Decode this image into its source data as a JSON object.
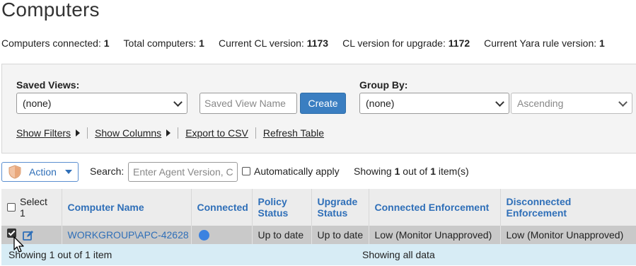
{
  "page": {
    "title": "Computers"
  },
  "stats": [
    {
      "label": "Computers connected:",
      "value": "1"
    },
    {
      "label": "Total computers:",
      "value": "1"
    },
    {
      "label": "Current CL version:",
      "value": "1173"
    },
    {
      "label": "CL version for upgrade:",
      "value": "1172"
    },
    {
      "label": "Current Yara rule version:",
      "value": "1"
    }
  ],
  "filters": {
    "saved_views_label": "Saved Views:",
    "saved_views_value": "(none)",
    "saved_view_name_placeholder": "Saved View Name",
    "create_label": "Create",
    "group_by_label": "Group By:",
    "group_by_value": "(none)",
    "sort_value": "Ascending",
    "links": {
      "show_filters": "Show Filters",
      "show_columns": "Show Columns",
      "export_csv": "Export to CSV",
      "refresh_table": "Refresh Table"
    }
  },
  "toolbar": {
    "action_label": "Action",
    "search_label": "Search:",
    "search_placeholder": "Enter Agent Version, C",
    "auto_apply_label": "Automatically apply",
    "showing_prefix": "Showing",
    "showing_count": "1",
    "showing_mid": "out of",
    "showing_total": "1",
    "showing_suffix": "item(s)"
  },
  "table": {
    "columns": {
      "select": "Select 1",
      "computer_name": "Computer Name",
      "connected": "Connected",
      "policy_status": "Policy Status",
      "upgrade_status": "Upgrade Status",
      "connected_enforcement": "Connected Enforcement",
      "disconnected_enforcement": "Disconnected Enforcement"
    },
    "rows": [
      {
        "computer_name": "WORKGROUP\\APC-42628",
        "policy_status": "Up to date",
        "upgrade_status": "Up to date",
        "connected_enforcement": "Low (Monitor Unapproved)",
        "disconnected_enforcement": "Low (Monitor Unapproved)"
      }
    ]
  },
  "footer": {
    "left": "Showing 1 out of 1 item",
    "middle": "Showing all data"
  },
  "colors": {
    "accent": "#2f6fb8",
    "button": "#3a7ec1",
    "connected_dot": "#3b82e0",
    "footer_bg": "#d7ecf5"
  }
}
